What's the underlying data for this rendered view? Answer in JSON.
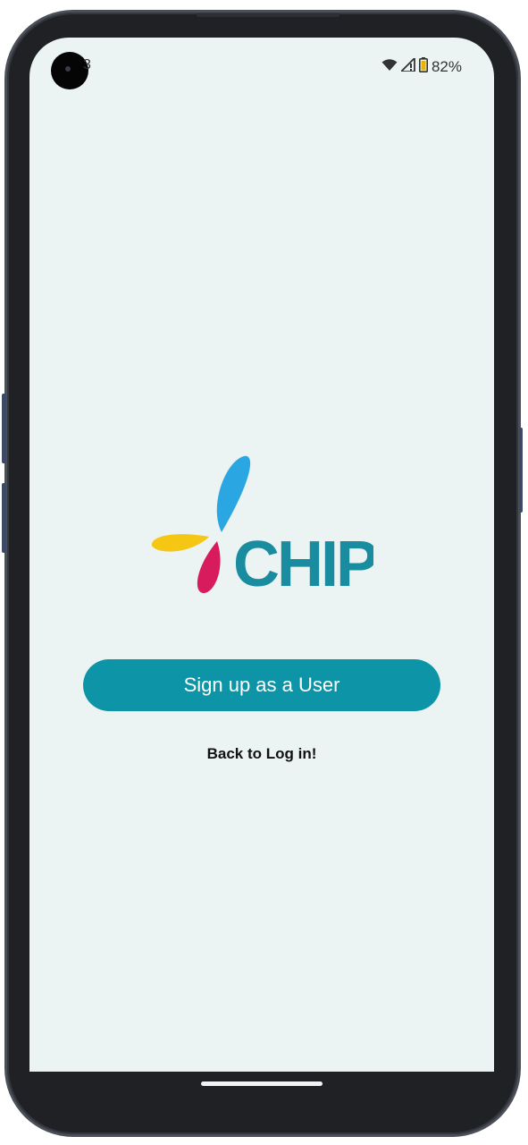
{
  "status_bar": {
    "time": "3",
    "battery": "82%",
    "icons": [
      "wifi-icon",
      "signal-icon",
      "battery-icon"
    ]
  },
  "logo": {
    "text": "CHIP",
    "colors": {
      "teal": "#1a8ca0",
      "blue": "#2aa6e2",
      "yellow": "#f6c614",
      "pink": "#d81b5c"
    }
  },
  "actions": {
    "signup_label": "Sign up as a User",
    "back_label": "Back to Log in!"
  },
  "theme": {
    "accent": "#0e94a7",
    "background": "#ebf3f3"
  }
}
